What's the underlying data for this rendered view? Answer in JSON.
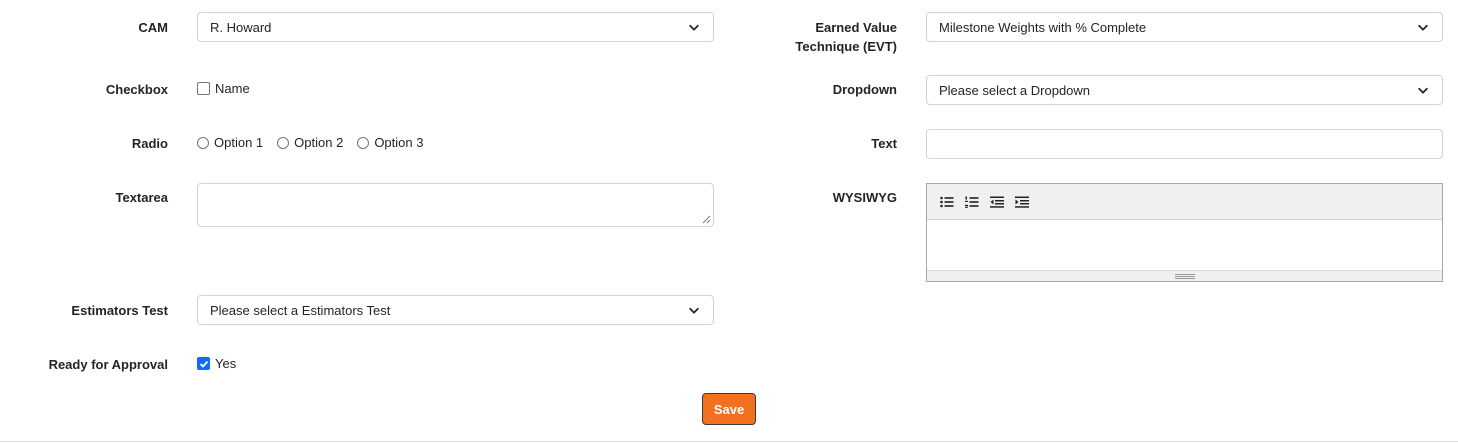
{
  "left": {
    "cam": {
      "label": "CAM",
      "value": "R. Howard"
    },
    "checkbox": {
      "label": "Checkbox",
      "option": "Name",
      "checked": false
    },
    "radio": {
      "label": "Radio",
      "options": [
        "Option 1",
        "Option 2",
        "Option 3"
      ]
    },
    "textarea": {
      "label": "Textarea",
      "value": ""
    },
    "estimators": {
      "label": "Estimators Test",
      "value": "Please select a Estimators Test"
    },
    "approval": {
      "label": "Ready for Approval",
      "option": "Yes",
      "checked": true
    }
  },
  "right": {
    "evt": {
      "label_line1": "Earned Value",
      "label_line2": "Technique (EVT)",
      "value": "Milestone Weights with % Complete"
    },
    "dropdown": {
      "label": "Dropdown",
      "value": "Please select a Dropdown"
    },
    "text": {
      "label": "Text",
      "value": ""
    },
    "wysiwyg": {
      "label": "WYSIWYG",
      "tools": [
        "bulleted-list-icon",
        "numbered-list-icon",
        "outdent-icon",
        "indent-icon"
      ]
    }
  },
  "actions": {
    "save_label": "Save"
  },
  "colors": {
    "save_button": "#f37021",
    "checkbox_checked": "#0d6efd"
  }
}
